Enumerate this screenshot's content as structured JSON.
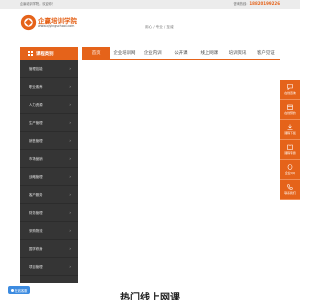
{
  "topbar": {
    "welcome": "企赢培训学院，欢迎你！",
    "hotline_label": "咨询热线：",
    "hotline_number": "18820199226"
  },
  "logo": {
    "name": "企赢培训学院",
    "url": "www.qiyingschool.com"
  },
  "slogan": "用心 / 专业 / 至诚",
  "sidebar": {
    "title": "课程类别",
    "items": [
      {
        "label": "管理技能"
      },
      {
        "label": "职业素养"
      },
      {
        "label": "人力资源"
      },
      {
        "label": "生产管理"
      },
      {
        "label": "销售管理"
      },
      {
        "label": "市场营销"
      },
      {
        "label": "战略管理"
      },
      {
        "label": "客户服务"
      },
      {
        "label": "财务管理"
      },
      {
        "label": "采购物流"
      },
      {
        "label": "国学修身"
      },
      {
        "label": "项目管理"
      }
    ]
  },
  "nav": [
    {
      "label": "首页",
      "active": true
    },
    {
      "label": "企业培训网"
    },
    {
      "label": "企业内训"
    },
    {
      "label": "公开课"
    },
    {
      "label": "线上网课"
    },
    {
      "label": "培训资讯"
    },
    {
      "label": "客户见证"
    }
  ],
  "floating_bar": [
    {
      "label": "在线咨询",
      "icon": "chat-icon"
    },
    {
      "label": "在线预约",
      "icon": "calendar-icon"
    },
    {
      "label": "课程下载",
      "icon": "download-icon"
    },
    {
      "label": "课程专题",
      "icon": "book-icon"
    },
    {
      "label": "企业QQ",
      "icon": "qq-icon"
    },
    {
      "label": "联系我们",
      "icon": "phone-icon"
    }
  ],
  "online_chat": "在线客服",
  "section_title": "热门线上网课",
  "colors": {
    "accent": "#e5631a",
    "sidebar_bg": "#353535",
    "topbar_bg": "#ececec",
    "chat_blue": "#3c8be0"
  }
}
